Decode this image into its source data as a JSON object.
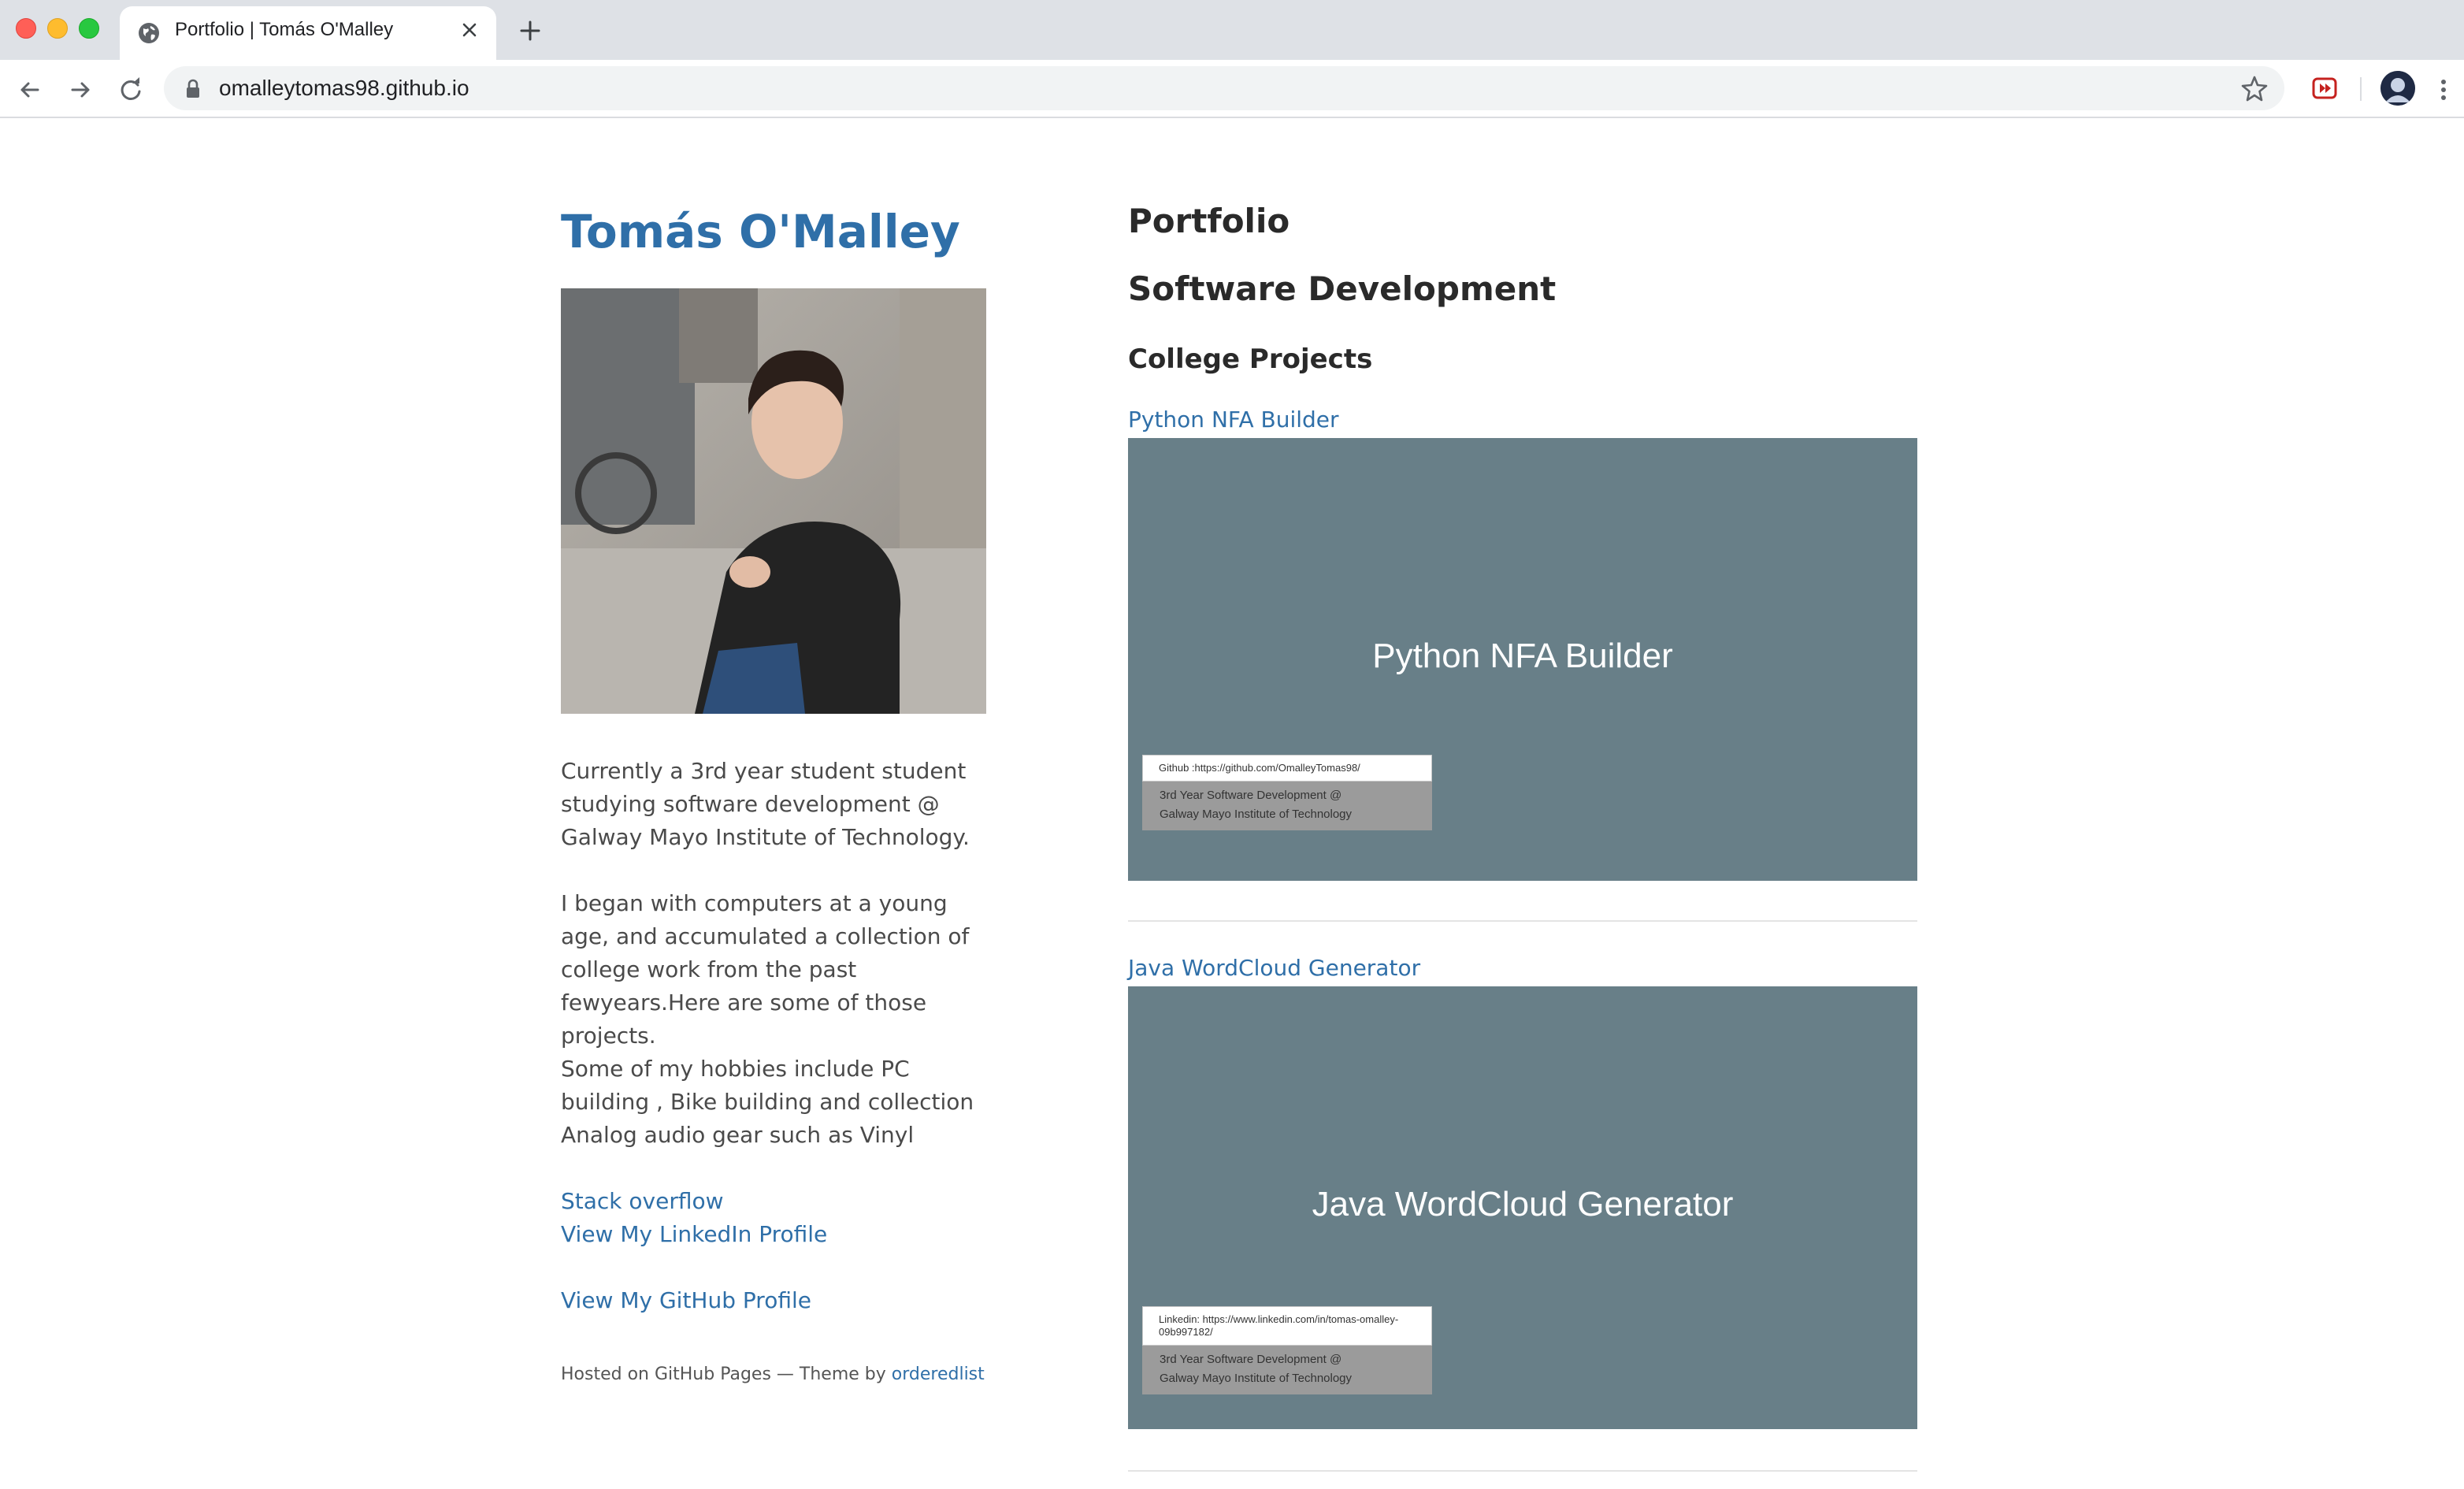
{
  "browser": {
    "tab_title": "Portfolio | Tomás O'Malley",
    "url": "omalleytomas98.github.io"
  },
  "sidebar": {
    "name": "Tomás O'Malley",
    "bio": [
      "Currently a 3rd year student student studying software development @ Galway Mayo Institute of Technology.",
      "I began with computers at a young age, and accumulated a collection of college work from the past fewyears.Here are some of those projects.",
      "Some of my hobbies include PC building , Bike building and collection Analog audio gear such as Vinyl"
    ],
    "links": {
      "stackoverflow": "Stack overflow",
      "linkedin": "View My LinkedIn Profile",
      "github": "View My GitHub Profile"
    },
    "footer_text": "Hosted on GitHub Pages — Theme by",
    "footer_link": "orderedlist"
  },
  "main": {
    "heading": "Portfolio",
    "subheading": "Software Development",
    "section": "College Projects",
    "projects": [
      {
        "link": "Python NFA Builder",
        "card_title": "Python NFA Builder",
        "tag_top": "Github :https://github.com/OmalleyTomas98/",
        "tag_line1": "3rd Year Software Development @",
        "tag_line2": "Galway Mayo Institute of Technology"
      },
      {
        "link": "Java WordCloud Generator",
        "card_title": "Java WordCloud Generator",
        "tag_top": "Linkedin: https://www.linkedin.com/in/tomas-omalley-09b997182/",
        "tag_line1": "3rd Year Software Development @",
        "tag_line2": "Galway Mayo Institute of Technology"
      }
    ]
  },
  "colors": {
    "link": "#2f6fa8",
    "card": "#687f88"
  }
}
